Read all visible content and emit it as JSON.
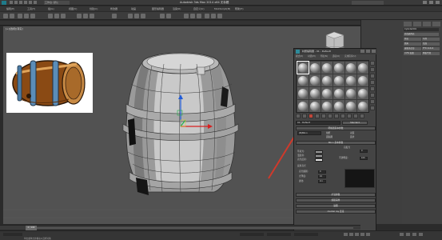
{
  "window": {
    "title": "Autodesk 3ds Max 2014 x64   无标题",
    "workspace": "工作台: 默认",
    "menu": [
      "编辑(E)",
      "工具(T)",
      "组(G)",
      "视图(V)",
      "创建(C)",
      "修改器",
      "动画",
      "图形编辑器",
      "渲染(R)",
      "自定义(U)",
      "MAXScript(M)",
      "帮助(H)"
    ]
  },
  "viewport": {
    "label": "[+][透视][真实]"
  },
  "material_editor": {
    "title": "材质编辑器 - 01 - Default",
    "menu": [
      "模式(D)",
      "材质(M)",
      "导航(N)",
      "选项(O)",
      "实用程序(U)"
    ],
    "material_name": "01 - Default",
    "material_type": "Standard",
    "shader_rollout": "明暗器基本参数",
    "shader_type": "(B)Blinn",
    "checkbox_labels": [
      "线框",
      "双面",
      "面贴图",
      "面状"
    ],
    "basic_rollout": "Blinn 基本参数",
    "self_illum_label": "自发光",
    "color_labels": [
      "环境光:",
      "漫反射:",
      "高光反射:"
    ],
    "color_value": "0",
    "opacity_label": "不透明度:",
    "opacity_value": "100",
    "specular_section": "反射高光",
    "specular_labels": [
      "高光级别:",
      "光泽度:",
      "柔化:"
    ],
    "specular_values": [
      "0",
      "10",
      "0.1"
    ],
    "rollouts": [
      "扩展参数",
      "超级采样",
      "贴图",
      "mental ray 连接"
    ]
  },
  "command_panel": {
    "name_field": "Cylinder001",
    "modifier_list": "修改器列表",
    "buttons": [
      "挤出",
      "车削",
      "倒角",
      "弯曲",
      "编辑多边形",
      "FFD 4x4x4",
      "UVW 贴图",
      "网格平滑"
    ]
  },
  "timeline": {
    "frame_label": "0 / 100"
  },
  "status": {
    "prompt": "单击或单击并拖动以选择对象"
  },
  "annotation": {
    "arrow_color": "#d0392b"
  }
}
